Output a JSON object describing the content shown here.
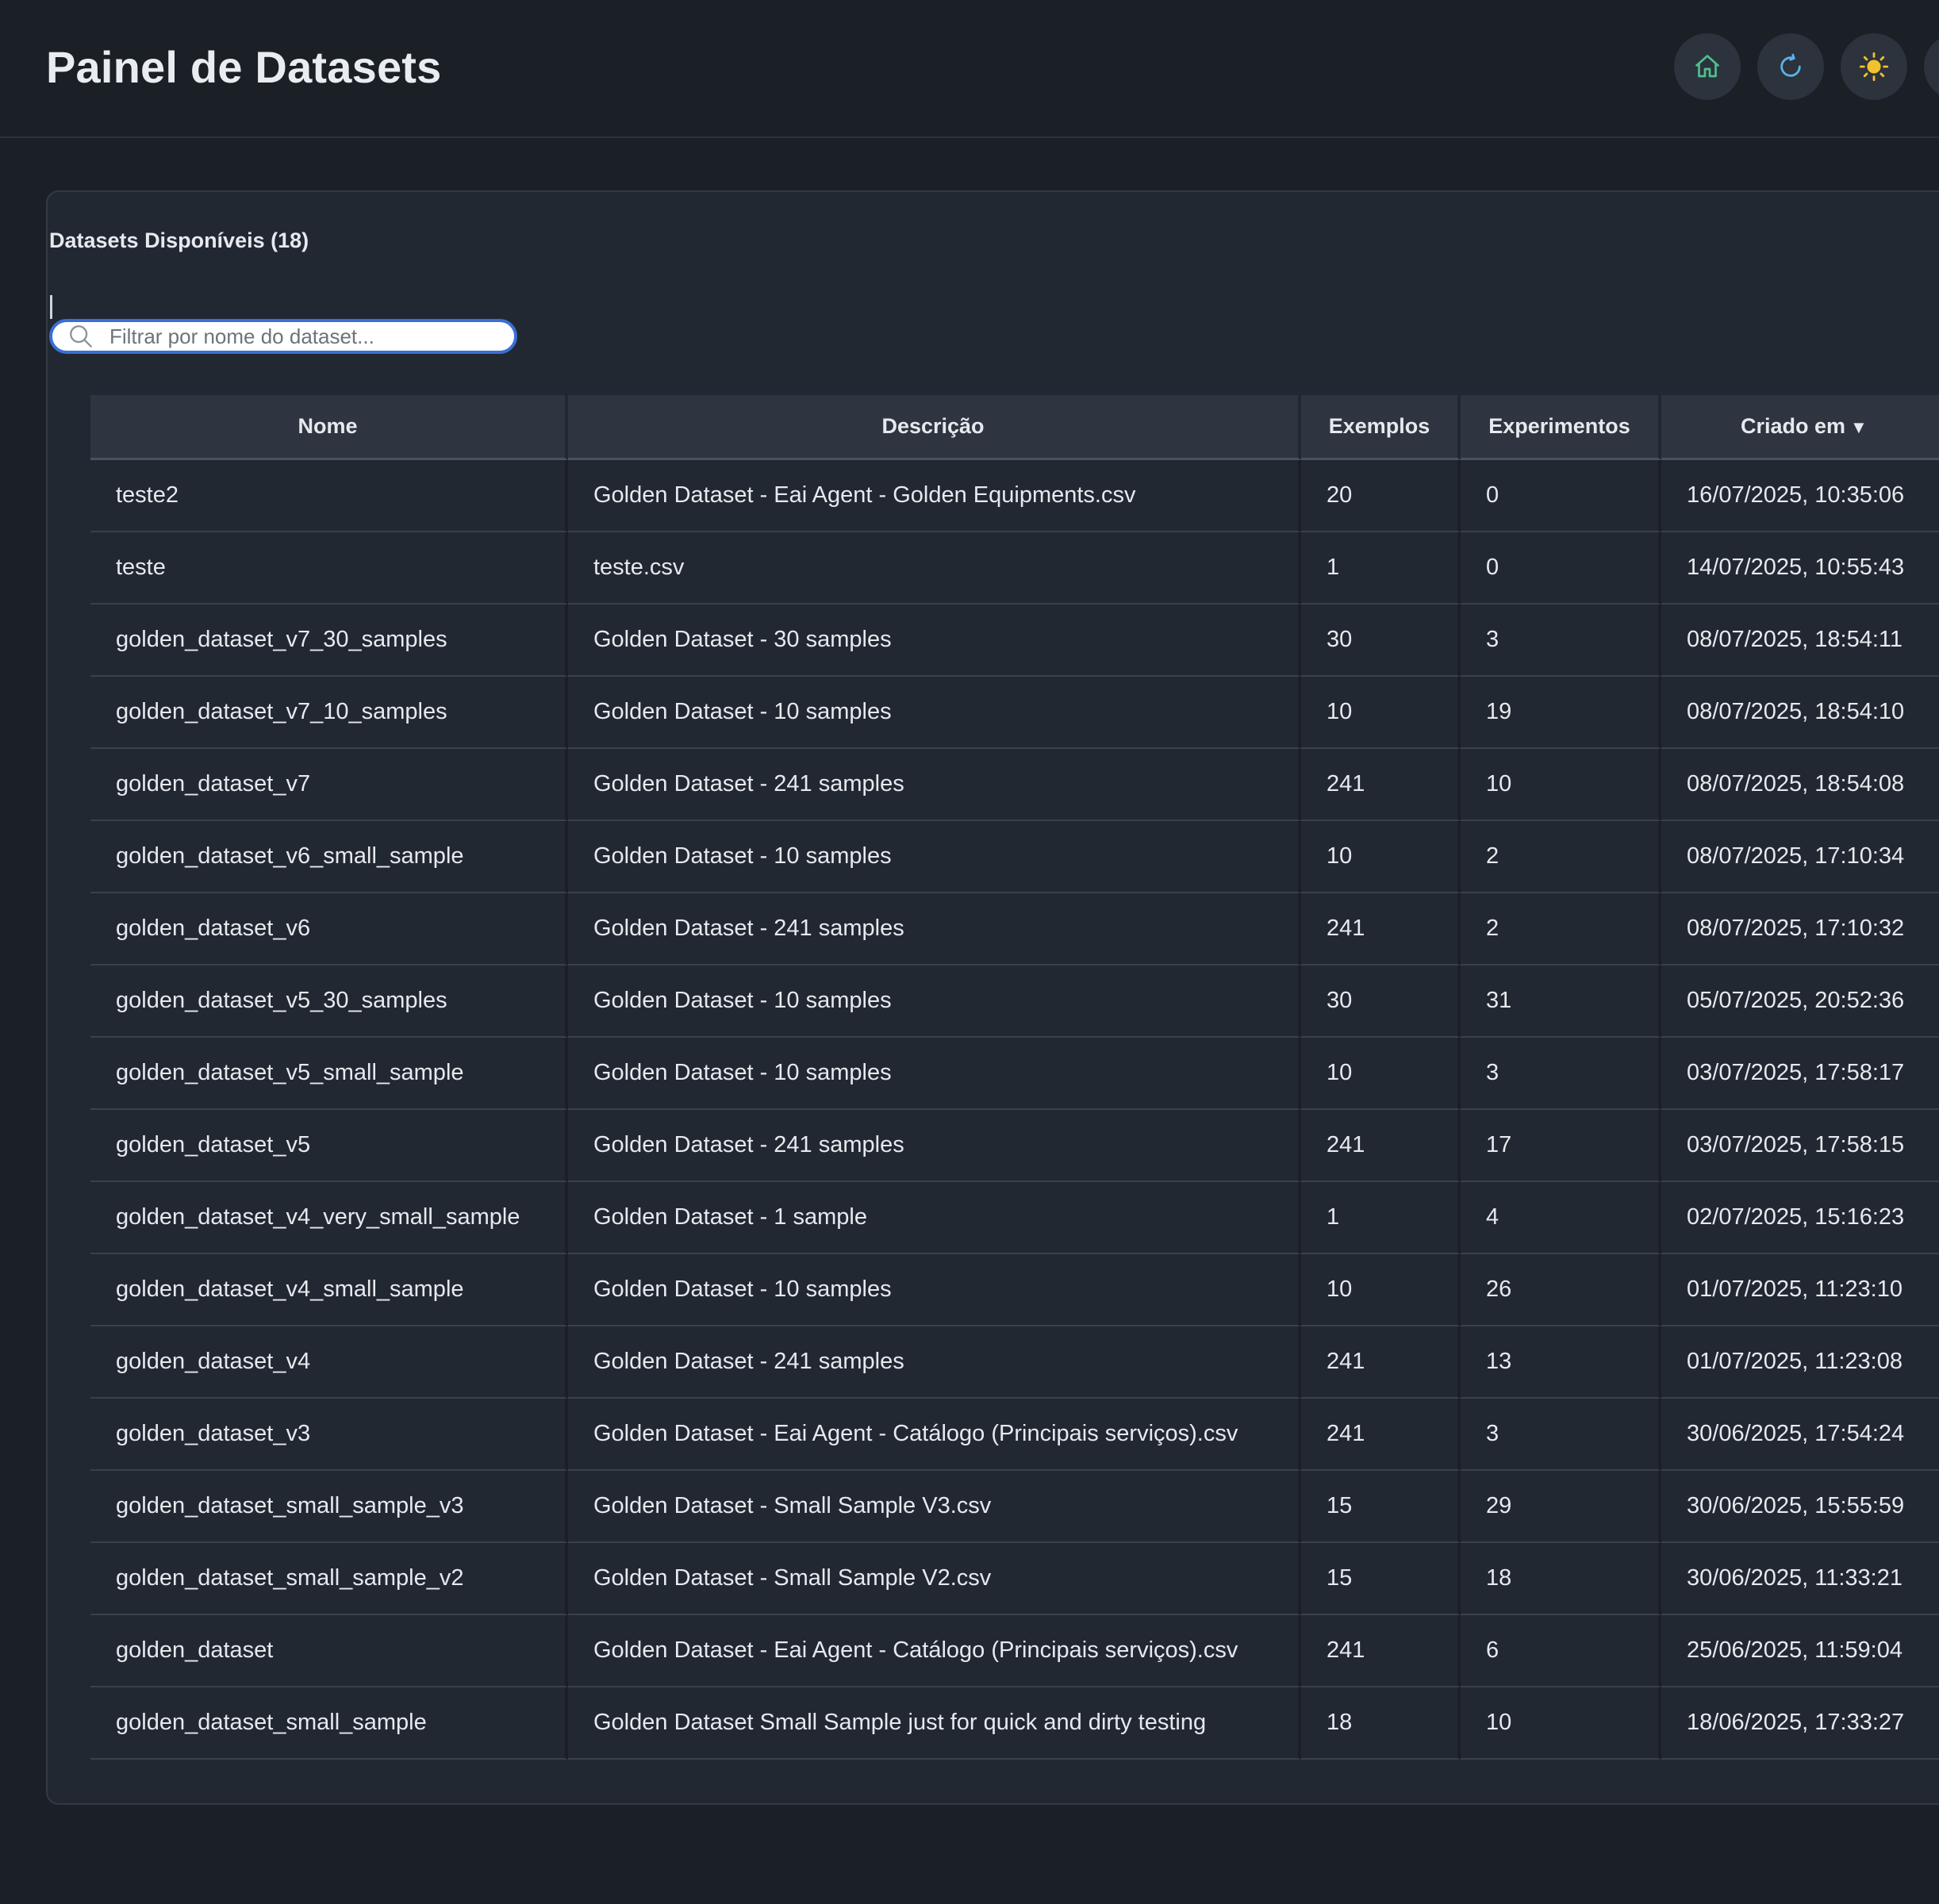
{
  "header": {
    "title": "Painel de Datasets",
    "buttons": [
      {
        "icon": "home-icon",
        "color": "#4fbf8f"
      },
      {
        "icon": "refresh-icon",
        "color": "#58b4e6"
      },
      {
        "icon": "sun-icon",
        "color": "#f2c12e"
      }
    ]
  },
  "panel": {
    "title": "Datasets Disponíveis (18)",
    "search": {
      "placeholder": "Filtrar por nome do dataset...",
      "value": ""
    }
  },
  "table": {
    "columns": [
      "Nome",
      "Descrição",
      "Exemplos",
      "Experimentos",
      "Criado em"
    ],
    "sort_indicator": "▼",
    "rows": [
      {
        "nome": "teste2",
        "descricao": "Golden Dataset - Eai Agent - Golden Equipments.csv",
        "exemplos": "20",
        "experimentos": "0",
        "criado_em": "16/07/2025, 10:35:06"
      },
      {
        "nome": "teste",
        "descricao": "teste.csv",
        "exemplos": "1",
        "experimentos": "0",
        "criado_em": "14/07/2025, 10:55:43"
      },
      {
        "nome": "golden_dataset_v7_30_samples",
        "descricao": "Golden Dataset - 30 samples",
        "exemplos": "30",
        "experimentos": "3",
        "criado_em": "08/07/2025, 18:54:11"
      },
      {
        "nome": "golden_dataset_v7_10_samples",
        "descricao": "Golden Dataset - 10 samples",
        "exemplos": "10",
        "experimentos": "19",
        "criado_em": "08/07/2025, 18:54:10"
      },
      {
        "nome": "golden_dataset_v7",
        "descricao": "Golden Dataset - 241 samples",
        "exemplos": "241",
        "experimentos": "10",
        "criado_em": "08/07/2025, 18:54:08"
      },
      {
        "nome": "golden_dataset_v6_small_sample",
        "descricao": "Golden Dataset - 10 samples",
        "exemplos": "10",
        "experimentos": "2",
        "criado_em": "08/07/2025, 17:10:34"
      },
      {
        "nome": "golden_dataset_v6",
        "descricao": "Golden Dataset - 241 samples",
        "exemplos": "241",
        "experimentos": "2",
        "criado_em": "08/07/2025, 17:10:32"
      },
      {
        "nome": "golden_dataset_v5_30_samples",
        "descricao": "Golden Dataset - 10 samples",
        "exemplos": "30",
        "experimentos": "31",
        "criado_em": "05/07/2025, 20:52:36"
      },
      {
        "nome": "golden_dataset_v5_small_sample",
        "descricao": "Golden Dataset - 10 samples",
        "exemplos": "10",
        "experimentos": "3",
        "criado_em": "03/07/2025, 17:58:17"
      },
      {
        "nome": "golden_dataset_v5",
        "descricao": "Golden Dataset - 241 samples",
        "exemplos": "241",
        "experimentos": "17",
        "criado_em": "03/07/2025, 17:58:15"
      },
      {
        "nome": "golden_dataset_v4_very_small_sample",
        "descricao": "Golden Dataset - 1 sample",
        "exemplos": "1",
        "experimentos": "4",
        "criado_em": "02/07/2025, 15:16:23"
      },
      {
        "nome": "golden_dataset_v4_small_sample",
        "descricao": "Golden Dataset - 10 samples",
        "exemplos": "10",
        "experimentos": "26",
        "criado_em": "01/07/2025, 11:23:10"
      },
      {
        "nome": "golden_dataset_v4",
        "descricao": "Golden Dataset - 241 samples",
        "exemplos": "241",
        "experimentos": "13",
        "criado_em": "01/07/2025, 11:23:08"
      },
      {
        "nome": "golden_dataset_v3",
        "descricao": "Golden Dataset - Eai Agent - Catálogo (Principais serviços).csv",
        "exemplos": "241",
        "experimentos": "3",
        "criado_em": "30/06/2025, 17:54:24"
      },
      {
        "nome": "golden_dataset_small_sample_v3",
        "descricao": "Golden Dataset - Small Sample V3.csv",
        "exemplos": "15",
        "experimentos": "29",
        "criado_em": "30/06/2025, 15:55:59"
      },
      {
        "nome": "golden_dataset_small_sample_v2",
        "descricao": "Golden Dataset - Small Sample V2.csv",
        "exemplos": "15",
        "experimentos": "18",
        "criado_em": "30/06/2025, 11:33:21"
      },
      {
        "nome": "golden_dataset",
        "descricao": "Golden Dataset - Eai Agent - Catálogo (Principais serviços).csv",
        "exemplos": "241",
        "experimentos": "6",
        "criado_em": "25/06/2025, 11:59:04"
      },
      {
        "nome": "golden_dataset_small_sample",
        "descricao": "Golden Dataset Small Sample just for quick and dirty testing",
        "exemplos": "18",
        "experimentos": "10",
        "criado_em": "18/06/2025, 17:33:27"
      }
    ]
  }
}
